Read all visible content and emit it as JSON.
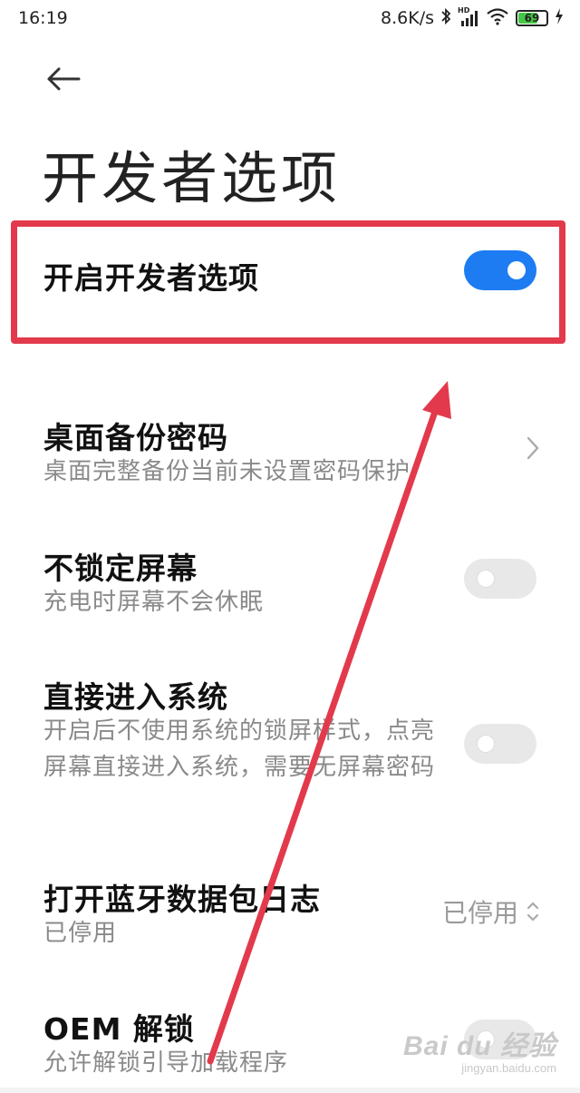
{
  "status_bar": {
    "time": "16:19",
    "net_speed": "8.6K/s",
    "signal_label": "HD",
    "battery_level": "69"
  },
  "header": {
    "back_icon": "arrow-left-icon",
    "title": "开发者选项"
  },
  "settings": {
    "developer_options": {
      "title": "开启开发者选项",
      "enabled": true
    },
    "desktop_backup_password": {
      "title": "桌面备份密码",
      "subtitle": "桌面完整备份当前未设置密码保护"
    },
    "stay_awake": {
      "title": "不锁定屏幕",
      "subtitle": "充电时屏幕不会休眠",
      "enabled": false
    },
    "direct_enter_system": {
      "title": "直接进入系统",
      "subtitle": "开启后不使用系统的锁屏样式，点亮屏幕直接进入系统，需要无屏幕密码",
      "enabled": false
    },
    "bluetooth_hci_log": {
      "title": "打开蓝牙数据包日志",
      "subtitle": "已停用",
      "value": "已停用"
    },
    "oem_unlock": {
      "title": "OEM 解锁",
      "subtitle": "允许解锁引导加载程序",
      "enabled": false
    }
  },
  "watermark": {
    "brand": "Bai du 经验",
    "url": "jingyan.baidu.com"
  },
  "colors": {
    "accent": "#1d7cf2",
    "annotation": "#e23a4c"
  }
}
